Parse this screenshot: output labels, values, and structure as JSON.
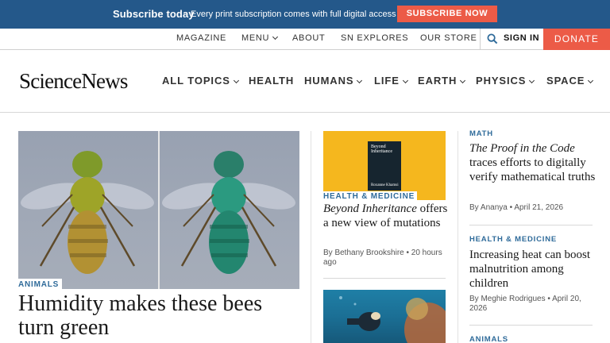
{
  "promo": {
    "title": "Subscribe today",
    "text": "Every print subscription comes with full digital access",
    "button": "SUBSCRIBE NOW"
  },
  "utility": {
    "magazine": "MAGAZINE",
    "menu": "MENU",
    "about": "ABOUT",
    "sn_explores": "SN EXPLORES",
    "our_store": "OUR STORE",
    "sign_in": "SIGN IN",
    "donate": "DONATE"
  },
  "nav": {
    "logo": "ScienceNews",
    "items": [
      "ALL TOPICS",
      "HEALTH",
      "HUMANS",
      "LIFE",
      "EARTH",
      "PHYSICS",
      "SPACE"
    ]
  },
  "hero": {
    "tag": "ANIMALS",
    "title": "Humidity makes these bees turn green"
  },
  "col2": {
    "story1": {
      "tag": "HEALTH & MEDICINE",
      "title_italic": "Beyond Inheritance",
      "title_rest": " offers a new view of mutations",
      "byline": "By Bethany Brookshire • 20 hours ago",
      "book_title": "Beyond Inheritance",
      "book_author": "Roxanne Khamsi"
    }
  },
  "col3": {
    "story1": {
      "tag": "MATH",
      "title_italic": "The Proof in the Code",
      "title_rest": " traces efforts to digitally verify mathematical truths",
      "byline": "By Ananya • April 21, 2026"
    },
    "story2": {
      "tag": "HEALTH & MEDICINE",
      "title": "Increasing heat can boost malnutrition among children",
      "byline": "By Meghie Rodrigues • April 20, 2026"
    },
    "story3": {
      "tag": "ANIMALS"
    }
  },
  "colors": {
    "promo_bg": "#24588a",
    "accent": "#ec5b47",
    "tag": "#2f6b9a"
  }
}
